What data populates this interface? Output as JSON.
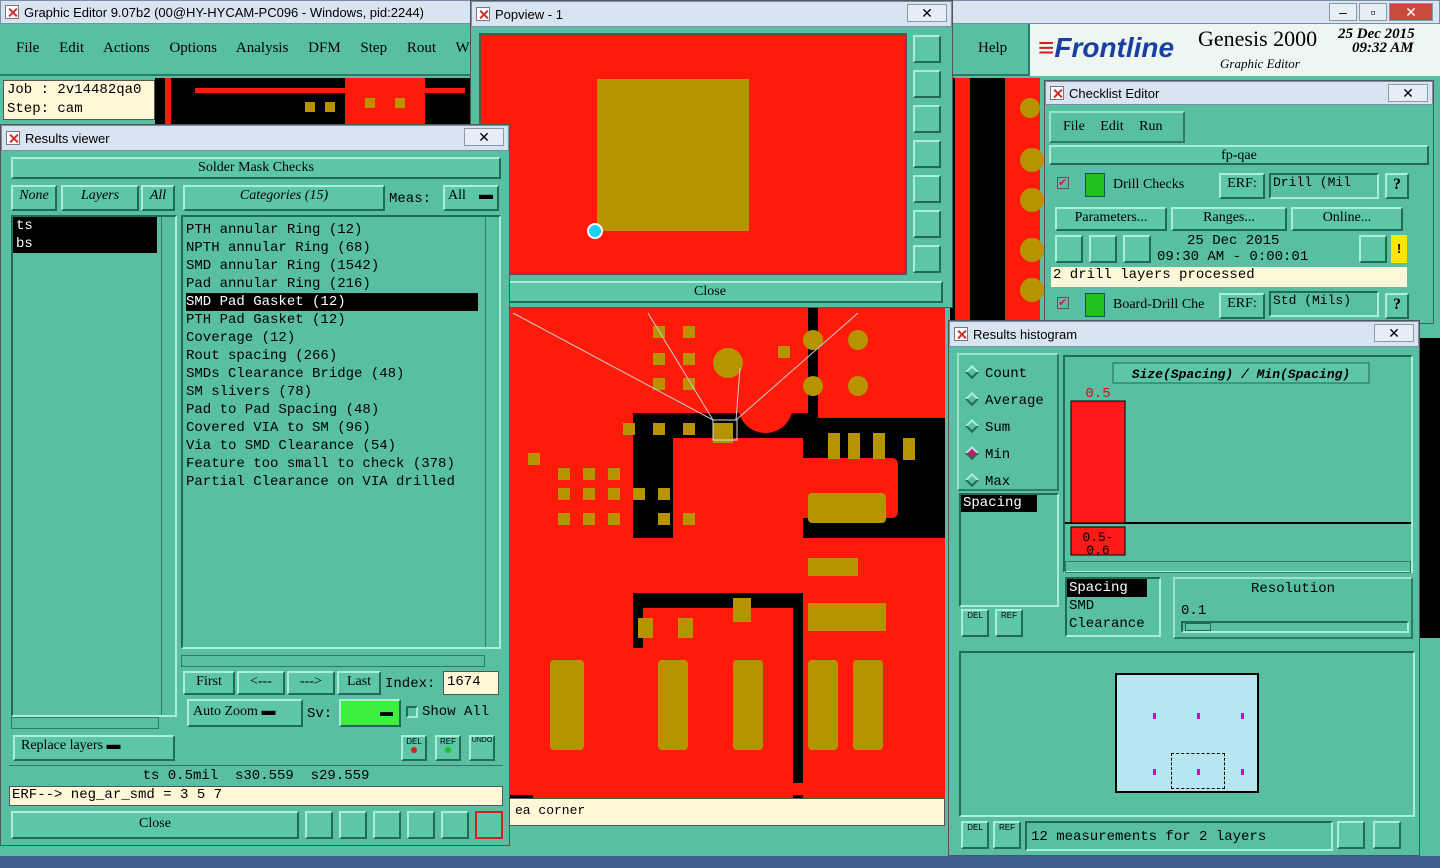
{
  "main_window": {
    "title": "Graphic Editor 9.07b2 (00@HY-HYCAM-PC096 - Windows, pid:2244)",
    "menu": [
      "File",
      "Edit",
      "Actions",
      "Options",
      "Analysis",
      "DFM",
      "Step",
      "Rout",
      "Wind"
    ],
    "help": "Help"
  },
  "job": {
    "job": "Job : 2v14482qa0",
    "step": "Step: cam"
  },
  "brand": {
    "logo": "Frontline",
    "product": "Genesis 2000",
    "subtitle": "Graphic Editor",
    "date": "25 Dec 2015",
    "time": "09:32 AM"
  },
  "popview": {
    "title": "Popview - 1",
    "close": "Close"
  },
  "results_viewer": {
    "title": "Results viewer",
    "heading": "Solder Mask Checks",
    "none": "None",
    "layers_label": "Layers",
    "all": "All",
    "categories_label": "Categories (15)",
    "meas_label": "Meas:",
    "meas_value": "All",
    "layers": [
      "ts",
      "bs"
    ],
    "categories": [
      "PTH annular Ring (12)",
      "NPTH annular Ring (68)",
      "SMD annular Ring (1542)",
      "Pad annular Ring (216)",
      "SMD Pad Gasket (12)",
      "PTH Pad Gasket (12)",
      "Coverage (12)",
      "Rout spacing (266)",
      "SMDs Clearance Bridge (48)",
      "SM slivers (78)",
      "Pad to Pad Spacing (48)",
      "Covered VIA to SM (96)",
      "Via to SMD Clearance (54)",
      "Feature too small to check (378)",
      "Partial Clearance on VIA drilled"
    ],
    "selected_category": "SMD Pad Gasket (12)",
    "nav": {
      "first": "First",
      "prev": "<---",
      "next": "--->",
      "last": "Last",
      "index_label": "Index:",
      "index_value": "1674"
    },
    "auto_zoom": "Auto Zoom",
    "sv_label": "Sv:",
    "show_all": "Show All",
    "replace_layers": "Replace layers",
    "status": "ts 0.5mil  s30.559  s29.559",
    "erf_line": "ERF--> neg_ar_smd = 3 5 7",
    "close": "Close",
    "del": "DEL",
    "ref": "REF",
    "undo": "UNDO"
  },
  "canvas_status": "ea corner",
  "checklist": {
    "title": "Checklist Editor",
    "menu": [
      "File",
      "Edit",
      "Run"
    ],
    "name": "fp-qae",
    "check1": {
      "label": "Drill Checks",
      "erf_label": "ERF:",
      "erf_value": "Drill (Mil",
      "date": "25 Dec 2015",
      "time": "09:30 AM - 0:00:01",
      "message": "2 drill layers processed"
    },
    "buttons": [
      "Parameters...",
      "Ranges...",
      "Online..."
    ],
    "check2": {
      "label": "Board-Drill Che",
      "erf_label": "ERF:",
      "erf_value": "Std (Mils)"
    }
  },
  "histogram": {
    "title": "Results histogram",
    "stats": [
      "Count",
      "Average",
      "Sum",
      "Min",
      "Max"
    ],
    "selected_stat": "Min",
    "list1": [
      "Spacing"
    ],
    "chart_title": "Size(Spacing) / Min(Spacing)",
    "list2": [
      "Spacing",
      "SMD",
      "Clearance"
    ],
    "resolution_label": "Resolution",
    "resolution_value": "0.1",
    "footer": "12 measurements for 2 layers",
    "del": "DEL",
    "ref": "REF"
  },
  "chart_data": {
    "type": "bar",
    "title": "Size(Spacing) / Min(Spacing)",
    "categories": [
      "0.5-0.6"
    ],
    "values": [
      0.5
    ],
    "data_labels": [
      "0.5"
    ],
    "bar_color": "#ff1a1a"
  }
}
